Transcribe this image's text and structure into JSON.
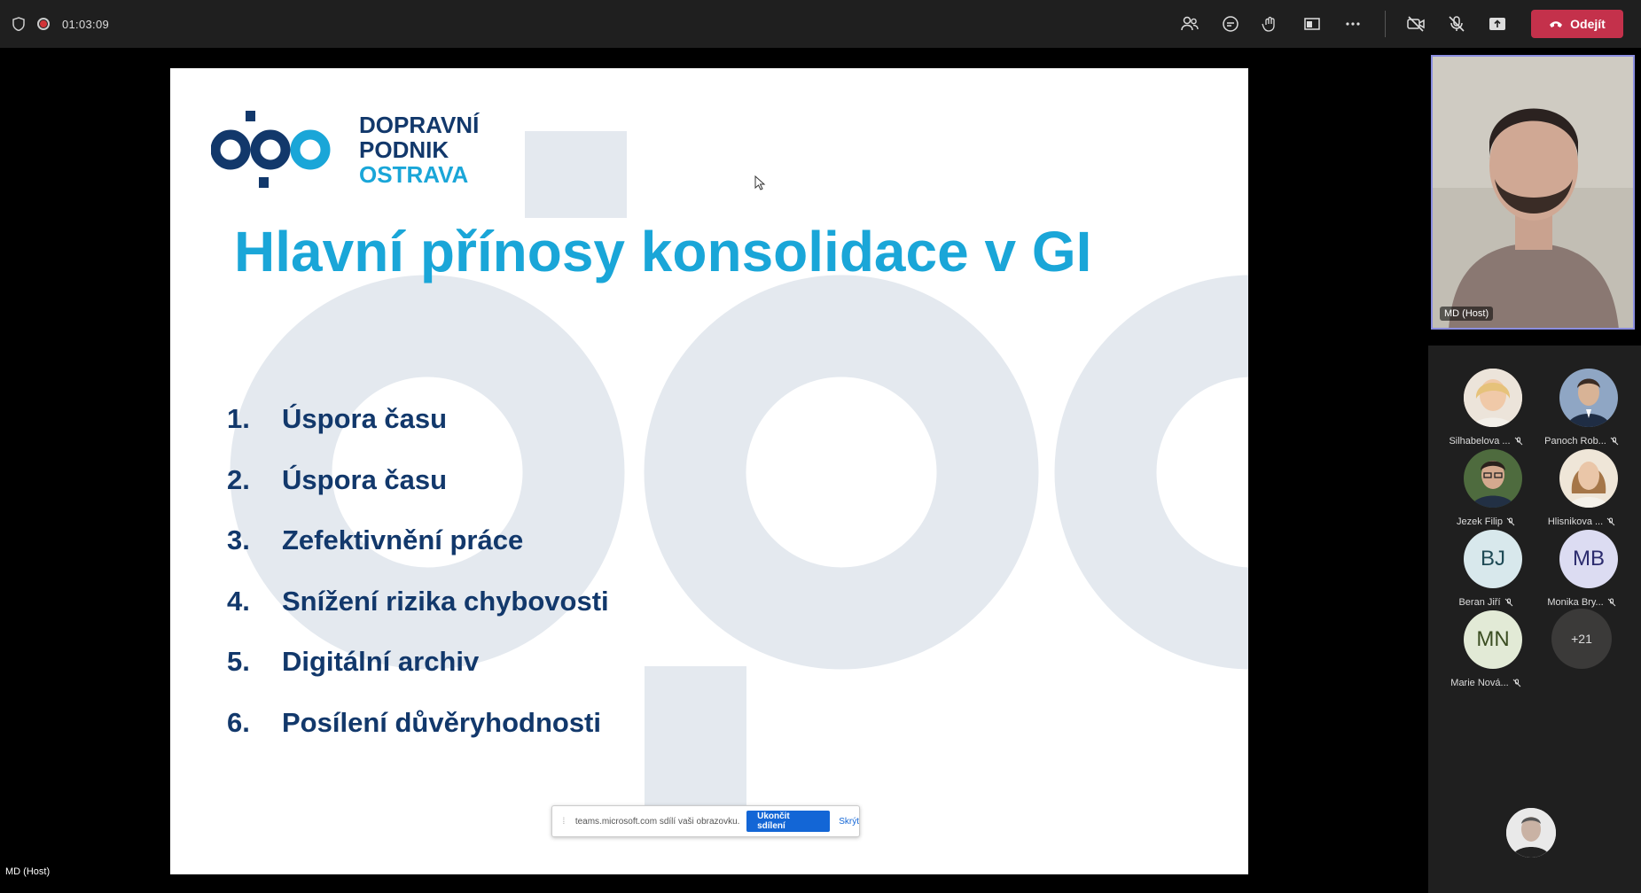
{
  "topbar": {
    "timer": "01:03:09",
    "leave_label": "Odejít",
    "icons": [
      "participants-icon",
      "chat-icon",
      "reactions-icon",
      "view-icon",
      "more-icon",
      "camera-off-icon",
      "mic-off-icon",
      "share-icon"
    ]
  },
  "slide": {
    "logo": {
      "line1": "DOPRAVNÍ",
      "line2": "PODNIK",
      "line3": "OSTRAVA"
    },
    "title": "Hlavní přínosy konsolidace v GI",
    "items": [
      {
        "num": "1.",
        "text": "Úspora času"
      },
      {
        "num": "2.",
        "text": "Úspora času"
      },
      {
        "num": "3.",
        "text": "Zefektivnění práce"
      },
      {
        "num": "4.",
        "text": "Snížení rizika chybovosti"
      },
      {
        "num": "5.",
        "text": "Digitální archiv"
      },
      {
        "num": "6.",
        "text": "Posílení důvěryhodnosti"
      }
    ]
  },
  "share_bar": {
    "message": "teams.microsoft.com sdílí vaši obrazovku.",
    "stop_label": "Ukončit sdílení",
    "hide_label": "Skrýt"
  },
  "self_label": "MD (Host)",
  "video": {
    "label": "MD (Host)"
  },
  "participants": [
    {
      "name": "Silhabelova ...",
      "initials": "",
      "muted": true
    },
    {
      "name": "Panoch Rob...",
      "initials": "",
      "muted": true
    },
    {
      "name": "Jezek Filip",
      "initials": "",
      "muted": true
    },
    {
      "name": "Hlisnikova ...",
      "initials": "",
      "muted": true
    },
    {
      "name": "Beran Jiří",
      "initials": "BJ",
      "muted": true
    },
    {
      "name": "Monika Bry...",
      "initials": "MB",
      "muted": true
    },
    {
      "name": "Marie Nová...",
      "initials": "MN",
      "muted": true
    }
  ],
  "more_count": "+21",
  "colors": {
    "brand_dark": "#12386b",
    "brand_light": "#1aa6d8",
    "leave_red": "#c4314b",
    "share_blue": "#1366d6"
  }
}
